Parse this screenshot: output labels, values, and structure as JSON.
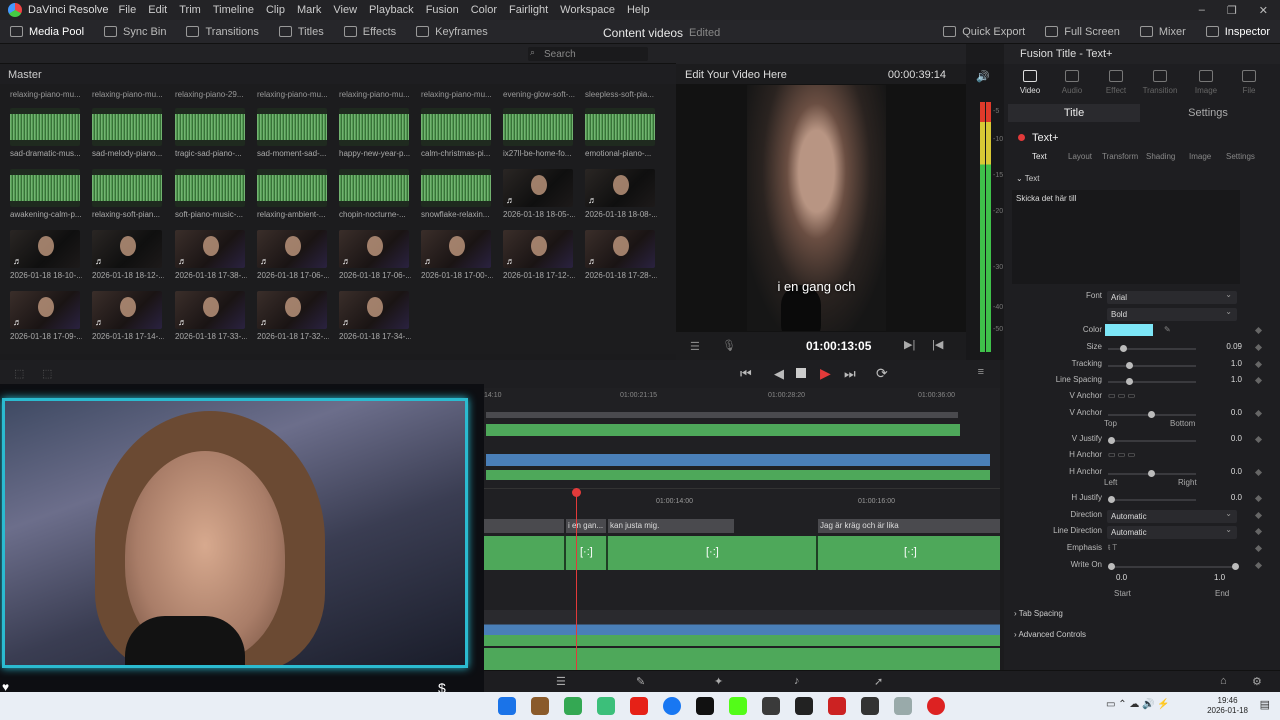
{
  "app": {
    "name": "DaVinci Resolve",
    "menu": [
      "File",
      "Edit",
      "Trim",
      "Timeline",
      "Clip",
      "Mark",
      "View",
      "Playback",
      "Fusion",
      "Color",
      "Fairlight",
      "Workspace",
      "Help"
    ]
  },
  "toolbar": {
    "left": [
      "Media Pool",
      "Sync Bin",
      "Transitions",
      "Titles",
      "Effects",
      "Keyframes"
    ],
    "project_title": "Content videos",
    "edited": "Edited",
    "right": [
      "Quick Export",
      "Full Screen",
      "Mixer",
      "Inspector"
    ]
  },
  "media_pool": {
    "search_placeholder": "Search",
    "bin": "Master",
    "top_labels": [
      "relaxing-piano-mu...",
      "relaxing-piano-mu...",
      "relaxing-piano-29...",
      "relaxing-piano-mu...",
      "relaxing-piano-mu...",
      "relaxing-piano-mu...",
      "evening-glow-soft-...",
      "sleepless-soft-pia..."
    ],
    "row1": [
      "sad-dramatic-mus...",
      "sad-melody-piano...",
      "tragic-sad-piano-...",
      "sad-moment-sad-...",
      "happy-new-year-p...",
      "calm-christmas-pi...",
      "ix27ll-be-home-fo...",
      "emotional-piano-..."
    ],
    "row2": [
      "awakening-calm-p...",
      "relaxing-soft-pian...",
      "soft-piano-music-...",
      "relaxing-ambient-...",
      "chopin-nocturne-...",
      "snowflake-relaxin...",
      "2026-01-18 18-05-...",
      "2026-01-18 18-08-..."
    ],
    "row3": [
      "2026-01-18 18-10-...",
      "2026-01-18 18-12-...",
      "2026-01-18 17-38-...",
      "2026-01-18 17-06-...",
      "2026-01-18 17-06-...",
      "2026-01-18 17-00-...",
      "2026-01-18 17-12-...",
      "2026-01-18 17-28-..."
    ],
    "row4": [
      "2026-01-18 17-09-...",
      "2026-01-18 17-14-...",
      "2026-01-18 17-33-...",
      "2026-01-18 17-32-...",
      "2026-01-18 17-34-..."
    ]
  },
  "viewer": {
    "title": "Edit Your Video Here",
    "duration": "00:00:39:14",
    "subtitle": "i en gang och",
    "timecode": "01:00:13:05"
  },
  "meters": {
    "scale": [
      "-5",
      "-10",
      "-15",
      "-20",
      "-30",
      "-40",
      "-50"
    ]
  },
  "inspector": {
    "title": "Fusion Title - Text+",
    "tabs": [
      "Video",
      "Audio",
      "Effect",
      "Transition",
      "Image",
      "File"
    ],
    "subtabs": [
      "Title",
      "Settings"
    ],
    "node": "Text+",
    "node_tabs": [
      "Text",
      "Layout",
      "Transform",
      "Shading",
      "Image",
      "Settings"
    ],
    "section": "Text",
    "text_value": "Skicka det här till",
    "font_label": "Font",
    "font": "Arial",
    "style": "Bold",
    "color_label": "Color",
    "color_hex": "#7de6f7",
    "size_label": "Size",
    "size": "0.09",
    "tracking_label": "Tracking",
    "tracking": "1.0",
    "line_spacing_label": "Line Spacing",
    "line_spacing": "1.0",
    "v_anchor_label": "V Anchor",
    "v_anchor2_label": "V Anchor",
    "v_anchor_val": "0.0",
    "top": "Top",
    "bottom": "Bottom",
    "v_justify_label": "V Justify",
    "v_justify": "0.0",
    "h_anchor_label": "H Anchor",
    "h_anchor2_label": "H Anchor",
    "h_anchor_val": "0.0",
    "left": "Left",
    "right": "Right",
    "h_justify_label": "H Justify",
    "h_justify": "0.0",
    "direction_label": "Direction",
    "direction": "Automatic",
    "line_direction_label": "Line Direction",
    "line_direction": "Automatic",
    "emphasis_label": "Emphasis",
    "write_on_label": "Write On",
    "start_val": "0.0",
    "end_val": "1.0",
    "start": "Start",
    "end": "End",
    "tab_spacing": "Tab Spacing",
    "advanced": "Advanced Controls"
  },
  "timeline": {
    "ruler_top": [
      "01:00:21:15",
      "01:00:28:20",
      "01:00:36:00"
    ],
    "ruler_mid": [
      "01:00:14:00",
      "01:00:16:00"
    ],
    "subtitle_clips": [
      "i en gan...",
      "kan justa mig.",
      "Jag är kräg och är lika"
    ]
  },
  "taskbar": {
    "time": "19:46",
    "date": "2026-01-18"
  }
}
